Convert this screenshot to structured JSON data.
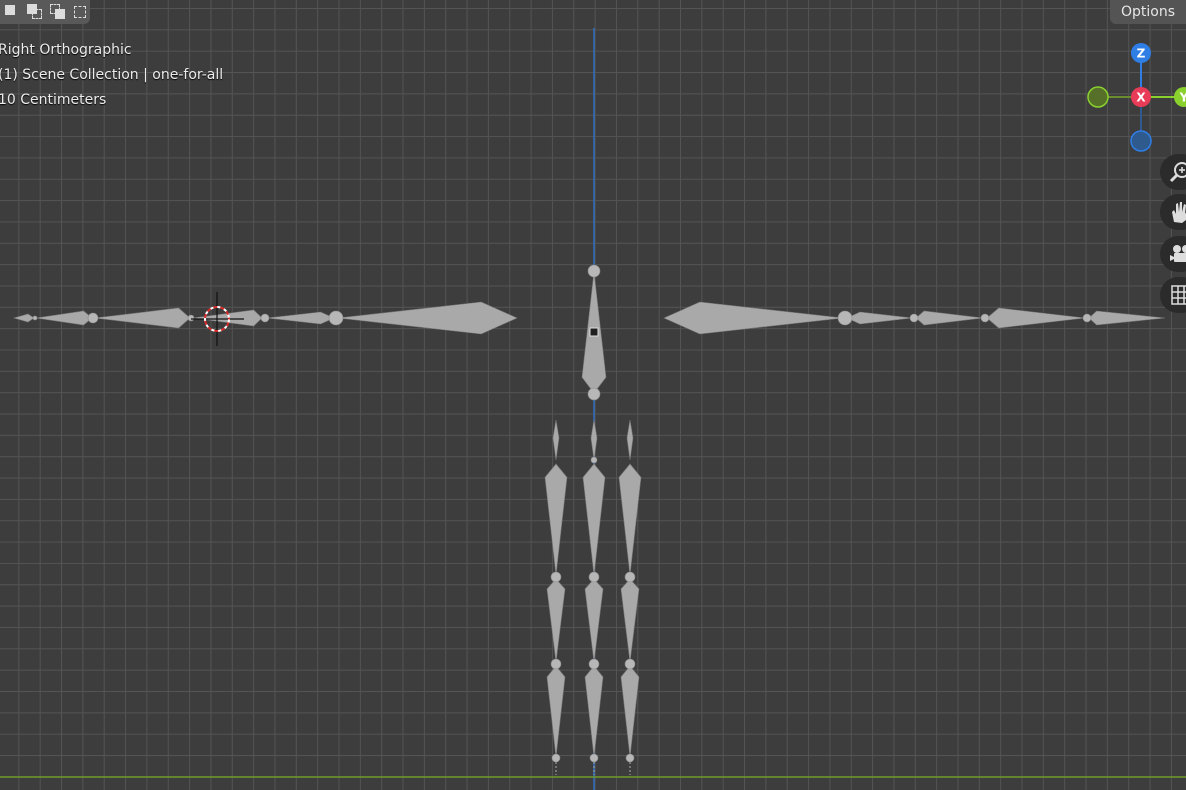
{
  "viewport": {
    "view_name": "Right Orthographic",
    "collection": "(1) Scene Collection | one-for-all",
    "scale": "10 Centimeters"
  },
  "header": {
    "options_label": "Options",
    "select_tools": [
      "select-box-new-icon",
      "select-box-extend-icon",
      "select-box-subtract-icon",
      "select-box-invert-icon"
    ]
  },
  "gizmo": {
    "axes": {
      "z": "Z",
      "x": "X",
      "y": "Y"
    },
    "colors": {
      "z": "#2f7ee6",
      "x": "#e83b57",
      "y": "#8bd12e",
      "y_neg": "#6c8d2f",
      "z_neg": "#2e5a8e"
    }
  },
  "nav_buttons": [
    "zoom-icon",
    "pan-hand-icon",
    "camera-icon",
    "grid-perspective-icon"
  ],
  "colors": {
    "background": "#3d3d3d",
    "grid": "#545454",
    "z_axis_line": "#2e6ec2",
    "y_axis_line": "#6f9b28",
    "bone": "#a9a9a9"
  }
}
